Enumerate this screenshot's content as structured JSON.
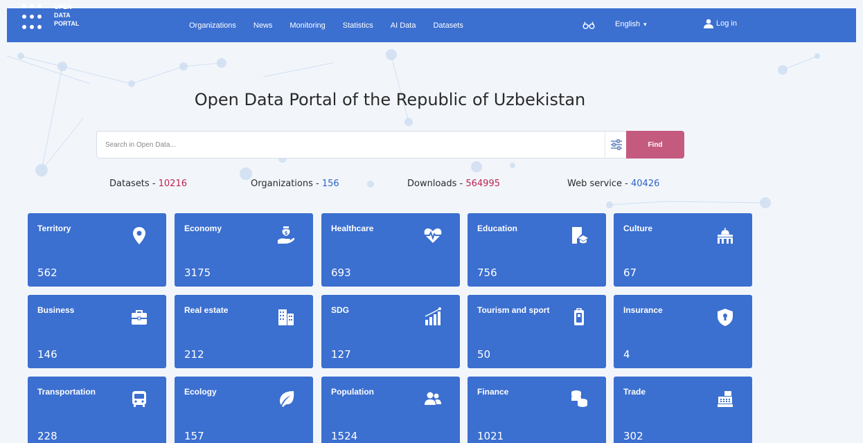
{
  "logo": {
    "line1": "OPEN",
    "line2": "DATA",
    "line3": "PORTAL"
  },
  "nav": {
    "items": [
      "Organizations",
      "News",
      "Monitoring",
      "Statistics",
      "AI Data",
      "Datasets"
    ],
    "language": "English",
    "language_caret": "▾",
    "login": "Log in"
  },
  "hero": {
    "title": "Open Data Portal of the Republic of Uzbekistan"
  },
  "search": {
    "placeholder": "Search in Open Data...",
    "find": "Find"
  },
  "stats": [
    {
      "label": "Datasets - ",
      "value": "10216",
      "color": "#c0224e"
    },
    {
      "label": "Organizations - ",
      "value": "156",
      "color": "#2b63c8"
    },
    {
      "label": "Downloads - ",
      "value": "564995",
      "color": "#c0224e"
    },
    {
      "label": "Web service - ",
      "value": "40426",
      "color": "#2b63c8"
    }
  ],
  "categories": [
    {
      "title": "Territory",
      "count": "562",
      "icon": "map-pin-icon"
    },
    {
      "title": "Economy",
      "count": "3175",
      "icon": "money-hand-icon"
    },
    {
      "title": "Healthcare",
      "count": "693",
      "icon": "heart-pulse-icon"
    },
    {
      "title": "Education",
      "count": "756",
      "icon": "book-graduation-icon"
    },
    {
      "title": "Culture",
      "count": "67",
      "icon": "mosque-icon"
    },
    {
      "title": "Business",
      "count": "146",
      "icon": "briefcase-icon"
    },
    {
      "title": "Real estate",
      "count": "212",
      "icon": "building-icon"
    },
    {
      "title": "SDG",
      "count": "127",
      "icon": "chart-growth-icon"
    },
    {
      "title": "Tourism and sport",
      "count": "50",
      "icon": "luggage-icon"
    },
    {
      "title": "Insurance",
      "count": "4",
      "icon": "shield-lock-icon"
    },
    {
      "title": "Transportation",
      "count": "228",
      "icon": "bus-icon"
    },
    {
      "title": "Ecology",
      "count": "157",
      "icon": "leaf-icon"
    },
    {
      "title": "Population",
      "count": "1524",
      "icon": "users-icon"
    },
    {
      "title": "Finance",
      "count": "1021",
      "icon": "coins-icon"
    },
    {
      "title": "Trade",
      "count": "302",
      "icon": "cash-register-icon"
    }
  ],
  "colors": {
    "nav_bg": "#3b6fd0",
    "card_bg": "#3b6fd0",
    "find_bg": "#c55a7f",
    "accent_red": "#c0224e",
    "accent_blue": "#2b63c8"
  }
}
